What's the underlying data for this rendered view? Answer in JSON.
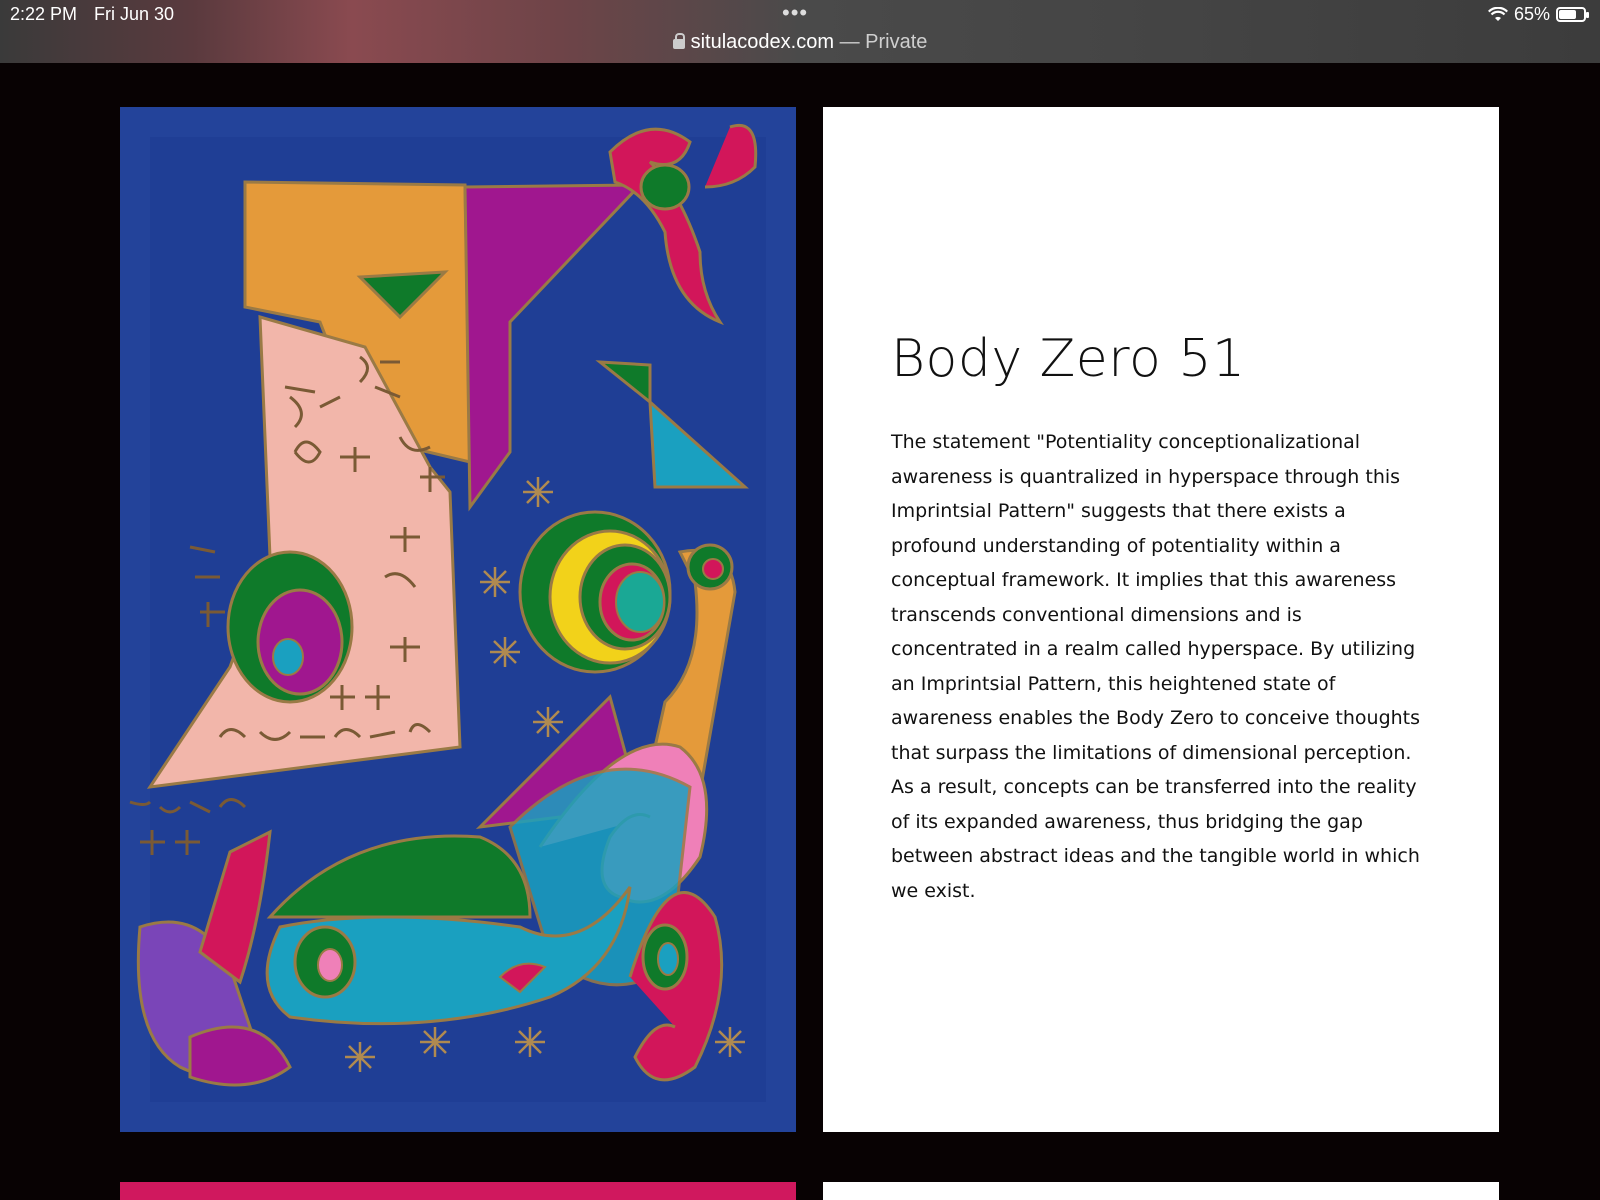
{
  "status_bar": {
    "time": "2:22 PM",
    "date": "Fri Jun 30",
    "dots": "•••",
    "battery": "65%",
    "battery_level": 0.65
  },
  "url_bar": {
    "domain": "situlacodex.com",
    "mode": " — Private"
  },
  "post": {
    "title": "Body Zero 51",
    "body": "The statement \"Potentiality conceptionalizational awareness is quantralized in hyperspace through this Imprintsial Pattern\" suggests that there exists a profound understanding of potentiality within a conceptual framework. It implies that this awareness transcends conventional dimensions and is concentrated in a realm called hyperspace. By utilizing an Imprintsial Pattern, this heightened state of awareness enables the Body Zero to conceive thoughts that surpass the limitations of dimensional perception. As a result, concepts can be transferred into the reality of its expanded awareness, thus bridging the gap between abstract ideas and the tangible world in which we exist."
  },
  "colors": {
    "page_bg": "#080203",
    "art_blue": "#23439a",
    "art_orange": "#e49a3a",
    "art_magenta": "#a0178f",
    "art_green": "#0f7a2a",
    "art_pink": "#f2b6aa",
    "art_red": "#d2165a",
    "art_yellow": "#f2d21a",
    "art_teal": "#1aa0c0",
    "outline_gold": "#9a7a45"
  }
}
